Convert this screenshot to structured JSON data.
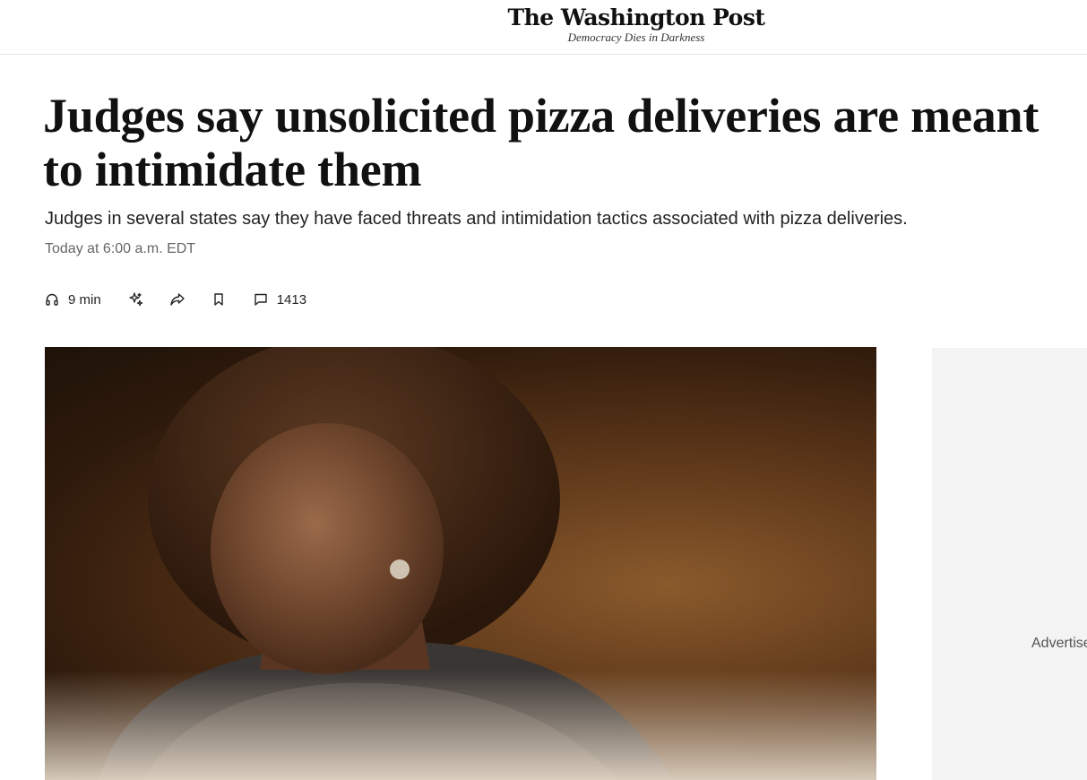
{
  "header": {
    "logo": "The Washington Post",
    "tagline": "Democracy Dies in Darkness"
  },
  "article": {
    "headline": "Judges say unsolicited pizza deliveries are meant to intimidate them",
    "subhead": "Judges in several states say they have faced threats and intimidation tactics associated with pizza deliveries.",
    "timestamp": "Today at 6:00 a.m. EDT"
  },
  "toolbar": {
    "listen_label": "9 min",
    "comments_count": "1413",
    "icons": [
      "headphones-icon",
      "gift-sparkle-icon",
      "share-arrow-icon",
      "bookmark-icon",
      "comment-bubble-icon"
    ]
  },
  "ad": {
    "label": "Advertisement"
  },
  "colors": {
    "text": "#111111",
    "muted": "#666666",
    "divider": "#e6e6e6",
    "ad_background": "#f3f3f3"
  }
}
